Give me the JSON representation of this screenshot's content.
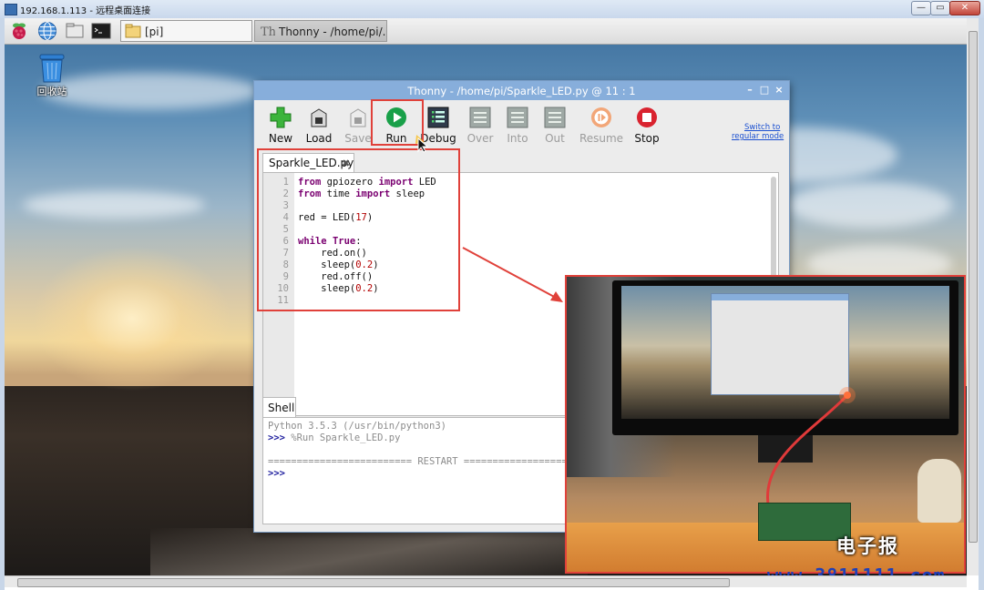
{
  "rdp": {
    "title": "192.168.1.113 - 远程桌面连接",
    "min": "—",
    "max": "▭",
    "close": "✕"
  },
  "taskbar": {
    "tasks": [
      {
        "label": "[pi]"
      },
      {
        "label": "Thonny  -  /home/pi/..."
      }
    ]
  },
  "desktop": {
    "trash_label": "回收站"
  },
  "thonny": {
    "title": "Thonny  -  /home/pi/Sparkle_LED.py  @  11 : 1",
    "tools": [
      {
        "label": "New",
        "icon": "plus-icon",
        "enabled": true
      },
      {
        "label": "Load",
        "icon": "load-icon",
        "enabled": true
      },
      {
        "label": "Save",
        "icon": "save-icon",
        "enabled": false
      },
      {
        "label": "Run",
        "icon": "run-icon",
        "enabled": true
      },
      {
        "label": "Debug",
        "icon": "debug-icon",
        "enabled": true
      },
      {
        "label": "Over",
        "icon": "step-over-icon",
        "enabled": false
      },
      {
        "label": "Into",
        "icon": "step-into-icon",
        "enabled": false
      },
      {
        "label": "Out",
        "icon": "step-out-icon",
        "enabled": false
      },
      {
        "label": "Resume",
        "icon": "resume-icon",
        "enabled": false
      },
      {
        "label": "Stop",
        "icon": "stop-icon",
        "enabled": true
      }
    ],
    "switch_mode": {
      "line1": "Switch to",
      "line2": "regular mode"
    },
    "editor_tab": "Sparkle_LED.py",
    "code_lines": [
      {
        "n": "1",
        "parts": [
          {
            "t": "from",
            "k": "kw"
          },
          {
            "t": " gpiozero "
          },
          {
            "t": "import",
            "k": "kw"
          },
          {
            "t": " LED"
          }
        ]
      },
      {
        "n": "2",
        "parts": [
          {
            "t": "from",
            "k": "kw"
          },
          {
            "t": " time "
          },
          {
            "t": "import",
            "k": "kw"
          },
          {
            "t": " sleep"
          }
        ]
      },
      {
        "n": "3",
        "parts": []
      },
      {
        "n": "4",
        "parts": [
          {
            "t": "red = LED("
          },
          {
            "t": "17",
            "k": "num"
          },
          {
            "t": ")"
          }
        ]
      },
      {
        "n": "5",
        "parts": []
      },
      {
        "n": "6",
        "parts": [
          {
            "t": "while",
            "k": "kw"
          },
          {
            "t": " "
          },
          {
            "t": "True",
            "k": "kw"
          },
          {
            "t": ":"
          }
        ]
      },
      {
        "n": "7",
        "parts": [
          {
            "t": "    red.on()"
          }
        ]
      },
      {
        "n": "8",
        "parts": [
          {
            "t": "    sleep("
          },
          {
            "t": "0.2",
            "k": "num"
          },
          {
            "t": ")"
          }
        ]
      },
      {
        "n": "9",
        "parts": [
          {
            "t": "    red.off()"
          }
        ]
      },
      {
        "n": "10",
        "parts": [
          {
            "t": "    sleep("
          },
          {
            "t": "0.2",
            "k": "num"
          },
          {
            "t": ")"
          }
        ]
      },
      {
        "n": "11",
        "parts": []
      }
    ],
    "shell_tab": "Shell",
    "shell": {
      "version": "Python 3.5.3 (/usr/bin/python3)",
      "prompt": ">>>",
      "run_cmd": " %Run Sparkle_LED.py",
      "restart": "========================= RESTART =========================",
      "prompt2": ">>>"
    }
  },
  "watermark": {
    "logo": "电子报",
    "url": "www.3811111.com"
  },
  "colors": {
    "accent_red": "#e0413a",
    "titlebar_blue": "#87aedb",
    "run_green": "#19a049",
    "stop_red": "#d9232f"
  }
}
